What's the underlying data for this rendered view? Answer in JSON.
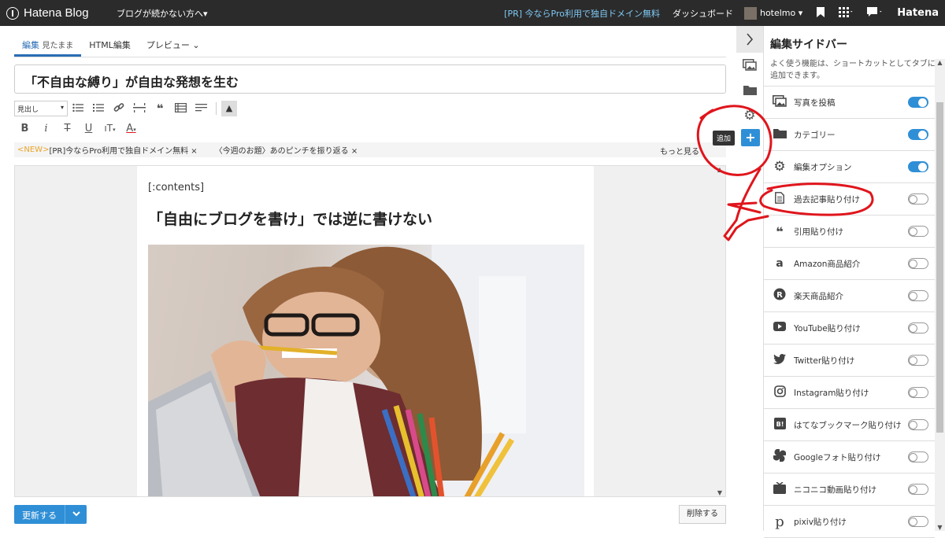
{
  "topbar": {
    "logo": "Hatena Blog",
    "blog_name": "ブログが続かない方へ▾",
    "pr": "[PR] 今ならPro利用で独自ドメイン無料",
    "dashboard": "ダッシュボード",
    "user": "hotelmo ▾",
    "brand": "Hatena"
  },
  "tabs": {
    "edit": "編集",
    "edit_sub": "見たまま",
    "html": "HTML編集",
    "preview": "プレビュー ⌄"
  },
  "title": "「不自由な縛り」が自由な発想を生む",
  "toolbar": {
    "heading_select": "見出し"
  },
  "notice": {
    "new_tag": "<NEW>",
    "item1": "[PR]今ならPro利用で独自ドメイン無料 ×",
    "item2": "〈今週のお題〉あのピンチを振り返る ×",
    "more": "もっと見る"
  },
  "editor": {
    "contents": "[:contents]",
    "heading": "「自由にブログを書け」では逆に書けない"
  },
  "footer": {
    "update": "更新する",
    "delete": "削除する"
  },
  "add_tooltip": "追加",
  "sidebar": {
    "title": "編集サイドバー",
    "desc": "よく使う機能は、ショートカットとしてタブに追加できます。",
    "items": [
      {
        "label": "写真を投稿",
        "icon": "photo-icon",
        "on": true
      },
      {
        "label": "カテゴリー",
        "icon": "folder-icon",
        "on": true
      },
      {
        "label": "編集オプション",
        "icon": "gear-icon",
        "on": true
      },
      {
        "label": "過去記事貼り付け",
        "icon": "document-icon",
        "on": false
      },
      {
        "label": "引用貼り付け",
        "icon": "quote-icon",
        "on": false
      },
      {
        "label": "Amazon商品紹介",
        "icon": "amazon-icon",
        "on": false
      },
      {
        "label": "楽天商品紹介",
        "icon": "rakuten-icon",
        "on": false
      },
      {
        "label": "YouTube貼り付け",
        "icon": "youtube-icon",
        "on": false
      },
      {
        "label": "Twitter貼り付け",
        "icon": "twitter-icon",
        "on": false
      },
      {
        "label": "Instagram貼り付け",
        "icon": "instagram-icon",
        "on": false
      },
      {
        "label": "はてなブックマーク貼り付け",
        "icon": "hatena-bookmark-icon",
        "on": false
      },
      {
        "label": "Googleフォト貼り付け",
        "icon": "google-photos-icon",
        "on": false
      },
      {
        "label": "ニコニコ動画貼り付け",
        "icon": "niconico-icon",
        "on": false
      },
      {
        "label": "pixiv貼り付け",
        "icon": "pixiv-icon",
        "on": false
      }
    ]
  },
  "colors": {
    "topbar": "#2b2b2b",
    "accent": "#2f8fd6",
    "pr_link": "#7ec9f5",
    "annotation": "#e0151c"
  }
}
